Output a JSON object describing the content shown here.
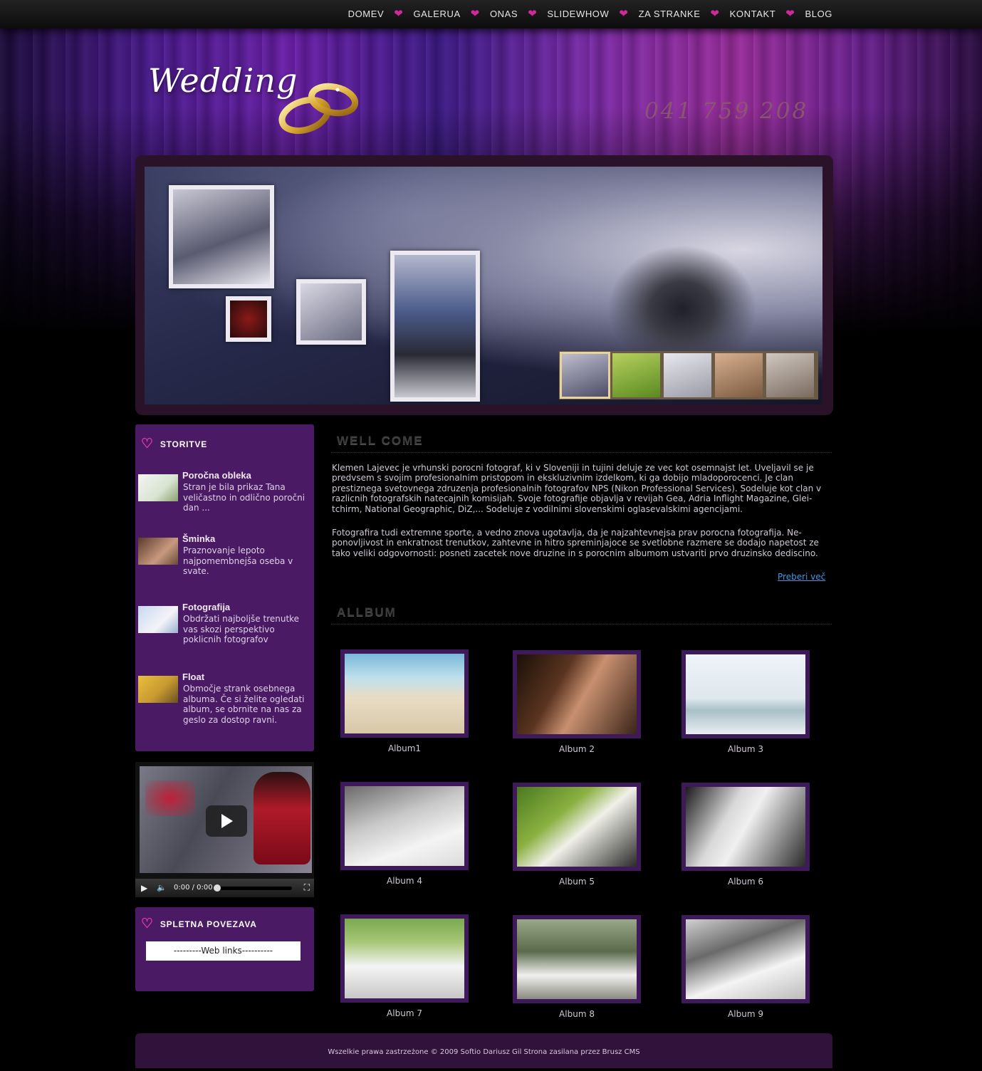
{
  "nav": {
    "items": [
      "DOMEV",
      "GALERUA",
      "ONAS",
      "SLIDEWHOW",
      "ZA STRANKE",
      "KONTAKT",
      "BLOG"
    ]
  },
  "header": {
    "logo_text": "Wedding",
    "phone": "041 759 208"
  },
  "sidebar": {
    "services_title": "STORITVE",
    "services": [
      {
        "title": "Poročna obleka",
        "text": "Stran je bila prikaz Tana veličastno in odlično poročni dan ..."
      },
      {
        "title": "Šminka",
        "text": "Praznovanje lepoto najpomembnejša oseba v svate."
      },
      {
        "title": "Fotografija",
        "text": "Obdržati najboljše trenutke vas skozi perspektivo poklicnih fotografov"
      },
      {
        "title": "Float",
        "text": "Območje strank osebnega albuma. Če si želite ogledati album, se obrnite na nas za geslo za dostop ravni."
      }
    ],
    "video_time": "0:00 / 0:00",
    "links_title": "SPLETNA POVEZAVA",
    "links_select": "---------Web links----------"
  },
  "main": {
    "welcome_title": "WELL COME",
    "paragraphs": [
      "Klemen Lajevec je vrhunski porocni fotograf, ki v Sloveniji in tujini deluje ze vec kot osemnajst let. Uveljavil se je predvsem s svojim profesionalnim pristopom in ekskluzivnim izdelkom, ki ga dobijo mladoporocenci. Je clan prestiznega svetovnega zdruzenja profesionalnih fotografov NPS (Nikon Professional Services). Sodeluje kot clan v razlicnih fotografskih natecajnih komisijah. Svoje fotografije objavlja v revijah Gea, Adria Inflight Magazine, Glei-tchirm, National Geographic, DiZ,... Sodeluje z vodilnimi slovenskimi oglasevalskimi agencijami.",
      "Fotografira tudi extremne sporte, a vedno znova ugotavlja, da je najzahtevnejsa prav porocna fotografija. Ne-ponovljivost in enkratnost trenutkov, zahtevne in hitro spreminjajoce se svetlobne razmere se dodajo napetost ze tako veliki odgovornosti: posneti zacetek nove druzine in s porocnim albumom ustvariti prvo druzinsko dediscino."
    ],
    "more_link": "Preberi več",
    "album_title": "ALLBUM",
    "albums": [
      "Album1",
      "Album 2",
      "Album 3",
      "Album 4",
      "Album 5",
      "Album 6",
      "Album 7",
      "Album 8",
      "Album 9"
    ]
  },
  "footer": {
    "text": "Wszelkie prawa zastrzeżone © 2009 Softio Dariusz Gil Strona zasilana przez Brusz CMS"
  },
  "colors": {
    "accent_pink": "#d02a9a",
    "sidebar_purple": "#4a1a64",
    "link_blue": "#3d9ae8",
    "thumb_highlight": "#e8d49a"
  }
}
